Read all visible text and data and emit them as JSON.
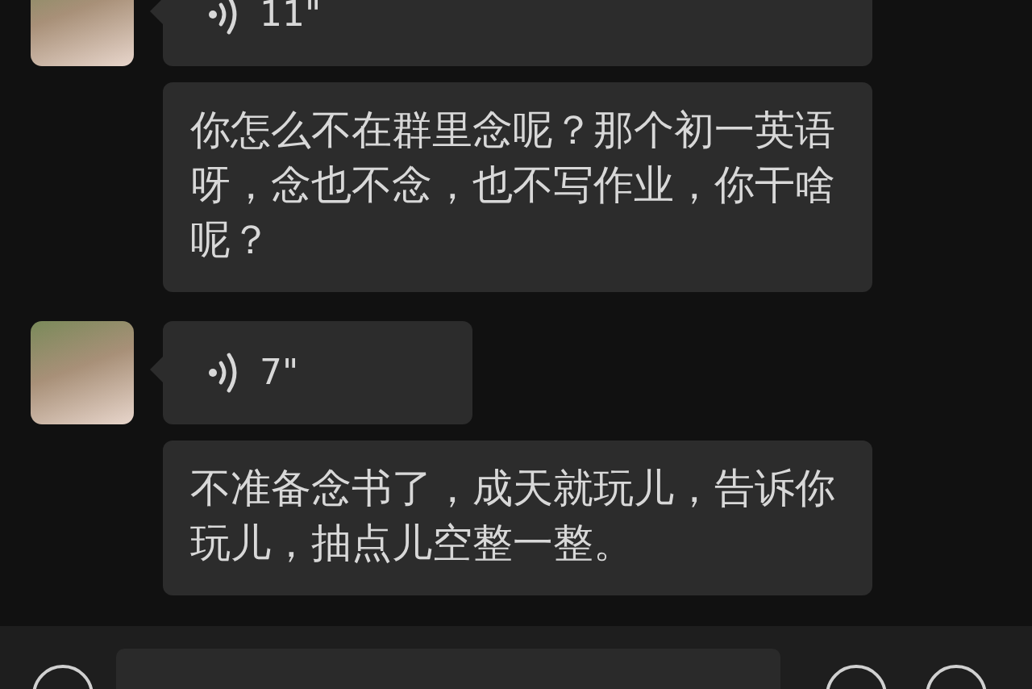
{
  "messages": [
    {
      "kind": "voice",
      "duration": "11\"",
      "wide": true
    },
    {
      "kind": "text",
      "text": "你怎么不在群里念呢？那个初一英语呀，念也不念，也不写作业，你干啥呢？"
    },
    {
      "kind": "voice",
      "duration": "7\"",
      "wide": false
    },
    {
      "kind": "text",
      "text": "不准备念书了，成天就玩儿，告诉你玩儿，抽点儿空整一整。"
    }
  ]
}
